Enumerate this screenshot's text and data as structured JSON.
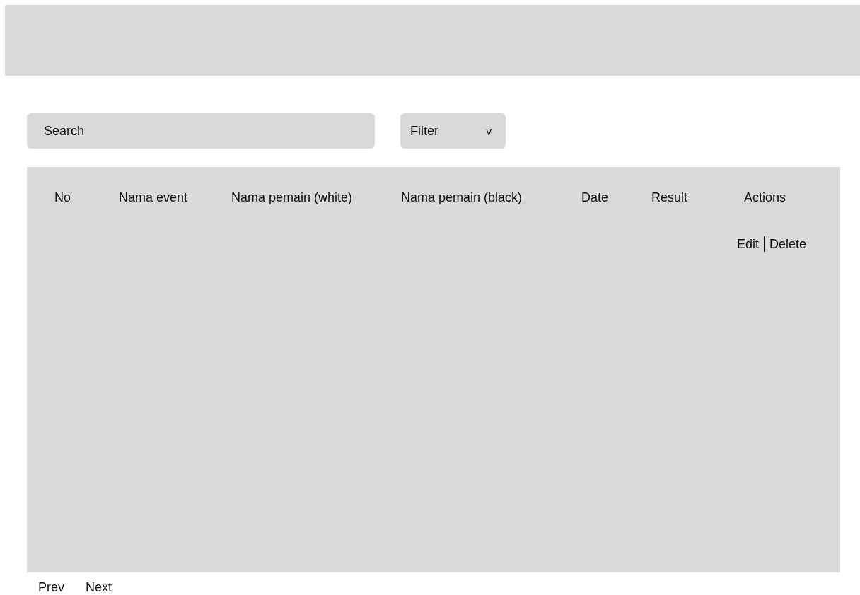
{
  "search": {
    "placeholder": "Search"
  },
  "filter": {
    "label": "Filter",
    "caret": "v"
  },
  "table": {
    "columns": [
      "No",
      "Nama event",
      "Nama pemain (white)",
      "Nama pemain (black)",
      "Date",
      "Result",
      "Actions"
    ],
    "rows": [
      {
        "actions": [
          "Edit",
          "Delete"
        ]
      }
    ]
  },
  "pagination": [
    "Prev",
    "Next"
  ]
}
